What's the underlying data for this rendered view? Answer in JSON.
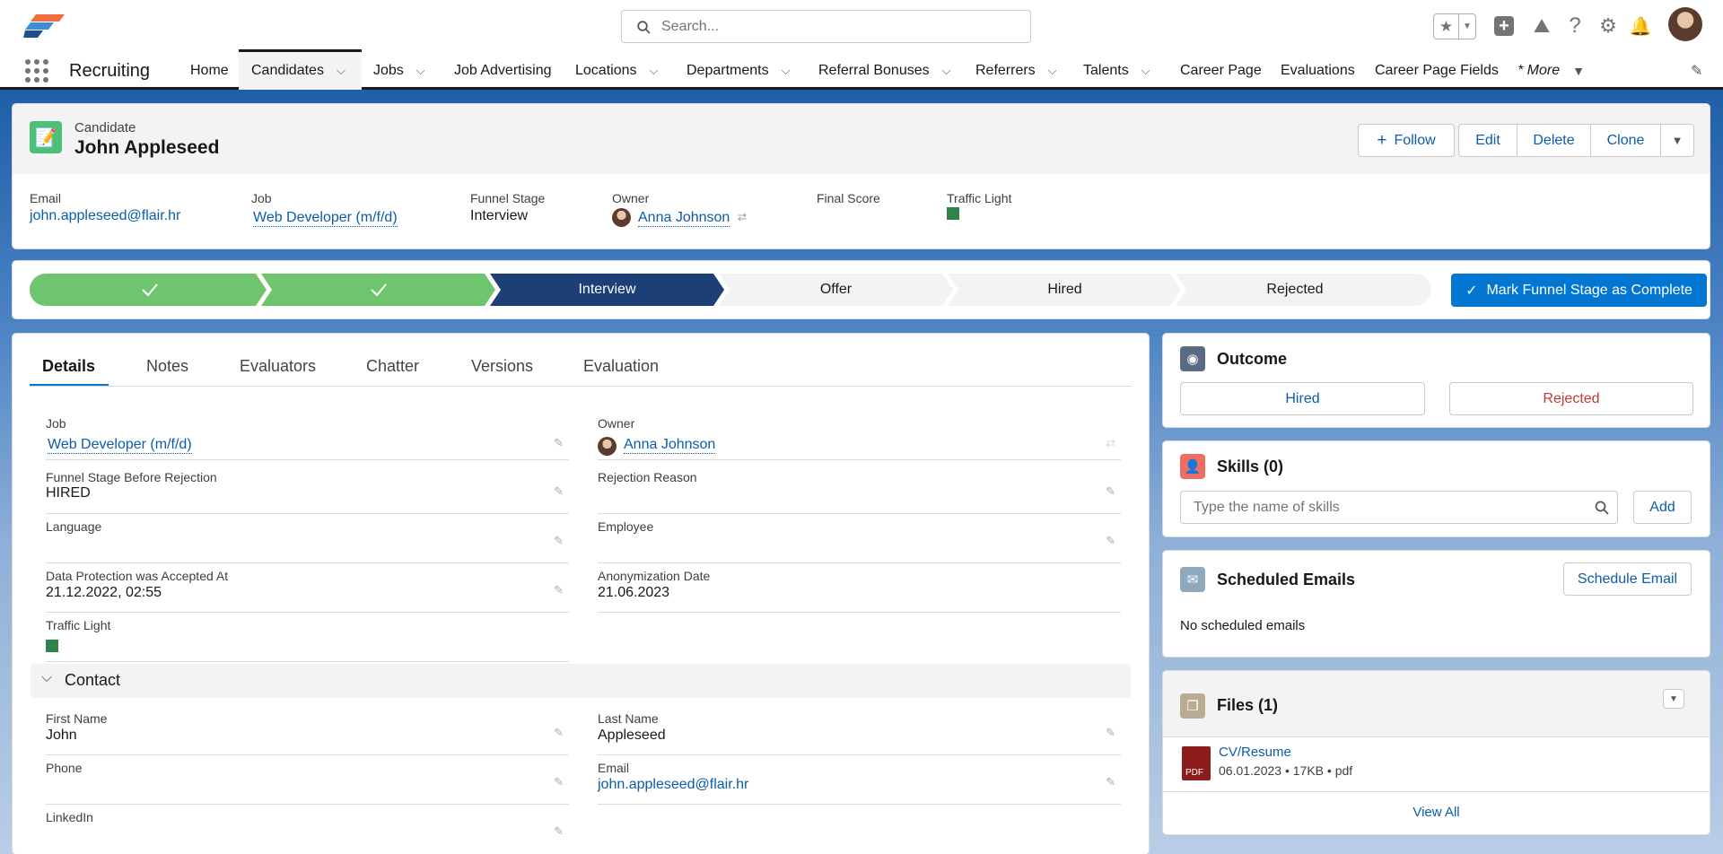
{
  "top": {
    "search_placeholder": "Search...",
    "icons": [
      "favorites-star-icon",
      "favorites-dropdown-icon",
      "add-icon",
      "trailhead-icon",
      "help-icon",
      "setup-gear-icon",
      "notifications-bell-icon",
      "user-avatar"
    ]
  },
  "nav": {
    "app_name": "Recruiting",
    "items": [
      {
        "label": "Home",
        "chevron": false
      },
      {
        "label": "Candidates",
        "chevron": true,
        "active": true
      },
      {
        "label": "Jobs",
        "chevron": true
      },
      {
        "label": "Job Advertising",
        "chevron": false
      },
      {
        "label": "Locations",
        "chevron": true
      },
      {
        "label": "Departments",
        "chevron": true
      },
      {
        "label": "Referral Bonuses",
        "chevron": true
      },
      {
        "label": "Referrers",
        "chevron": true
      },
      {
        "label": "Talents",
        "chevron": true
      },
      {
        "label": "Career Page",
        "chevron": false
      },
      {
        "label": "Evaluations",
        "chevron": false
      },
      {
        "label": "Career Page Fields",
        "chevron": false
      }
    ],
    "more_label": "* More"
  },
  "record": {
    "object_label": "Candidate",
    "name": "John Appleseed",
    "actions": {
      "follow": "Follow",
      "edit": "Edit",
      "delete": "Delete",
      "clone": "Clone"
    },
    "highlights": {
      "email_label": "Email",
      "email": "john.appleseed@flair.hr",
      "job_label": "Job",
      "job": "Web Developer (m/f/d)",
      "stage_label": "Funnel Stage",
      "stage": "Interview",
      "owner_label": "Owner",
      "owner": "Anna Johnson",
      "score_label": "Final Score",
      "traffic_label": "Traffic Light",
      "traffic_color": "#2e844a"
    }
  },
  "path": {
    "steps": [
      {
        "label": "",
        "state": "complete"
      },
      {
        "label": "",
        "state": "complete"
      },
      {
        "label": "Interview",
        "state": "current"
      },
      {
        "label": "Offer",
        "state": "incomplete"
      },
      {
        "label": "Hired",
        "state": "incomplete"
      },
      {
        "label": "Rejected",
        "state": "incomplete"
      }
    ],
    "mark_complete": "Mark Funnel Stage as Complete"
  },
  "tabs": [
    "Details",
    "Notes",
    "Evaluators",
    "Chatter",
    "Versions",
    "Evaluation"
  ],
  "details": {
    "job_label": "Job",
    "job": "Web Developer (m/f/d)",
    "owner_label": "Owner",
    "owner": "Anna Johnson",
    "fsbr_label": "Funnel Stage Before Rejection",
    "fsbr": "HIRED",
    "rejection_label": "Rejection Reason",
    "language_label": "Language",
    "employee_label": "Employee",
    "dpa_label": "Data Protection was Accepted At",
    "dpa": "21.12.2022, 02:55",
    "anon_label": "Anonymization Date",
    "anon": "21.06.2023",
    "traffic_label": "Traffic Light",
    "contact_section": "Contact",
    "first_label": "First Name",
    "first": "John",
    "last_label": "Last Name",
    "last": "Appleseed",
    "phone_label": "Phone",
    "email_label": "Email",
    "email": "john.appleseed@flair.hr",
    "linkedin_label": "LinkedIn"
  },
  "outcome": {
    "title": "Outcome",
    "hired": "Hired",
    "rejected": "Rejected"
  },
  "skills": {
    "title": "Skills (0)",
    "placeholder": "Type the name of skills",
    "add": "Add"
  },
  "emails": {
    "title": "Scheduled Emails",
    "button": "Schedule Email",
    "empty": "No scheduled emails"
  },
  "files": {
    "title": "Files (1)",
    "file_name": "CV/Resume",
    "file_date": "06.01.2023",
    "file_size": "17KB",
    "file_type": "pdf",
    "file_badge": "PDF",
    "view_all": "View All"
  }
}
